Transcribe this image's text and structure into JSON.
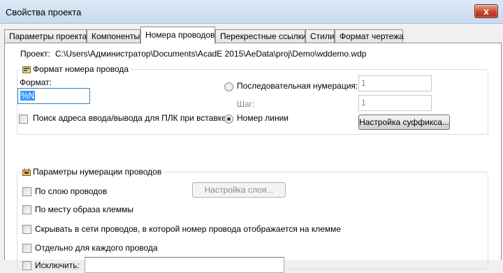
{
  "window": {
    "title": "Свойства проекта",
    "close_glyph": "x"
  },
  "tabs": [
    {
      "label": "Параметры проекта"
    },
    {
      "label": "Компоненты"
    },
    {
      "label": "Номера проводов",
      "active": true
    },
    {
      "label": "Перекрестные ссылки"
    },
    {
      "label": "Стили"
    },
    {
      "label": "Формат чертежа"
    }
  ],
  "project": {
    "label": "Проект:",
    "path": "C:\\Users\\Администратор\\Documents\\AcadE 2015\\AeData\\proj\\Demo\\wddemo.wdp"
  },
  "wire_format": {
    "title": "Формат номера провода",
    "icon": "wire-format-icon",
    "format_label": "Формат:",
    "format_value": "%N",
    "io_checkbox_label": "Поиск адреса ввода/вывода для ПЛК при вставке",
    "io_checked": false,
    "sequential_label": "Последовательная нумерация:",
    "sequential_value": "1",
    "step_label": "Шаг:",
    "step_value": "1",
    "line_number_label": "Номер линии",
    "selected_mode": "line_number",
    "suffix_button": "Настройка суффикса..."
  },
  "numbering": {
    "title": "Параметры нумерации проводов",
    "icon": "numbering-params-icon",
    "per_layer_label": "По слою проводов",
    "layer_setup_button": "Настройка слоя...",
    "terminal_label": "По месту образа клеммы",
    "hide_label": "Скрывать в сети проводов, в которой номер провода отображается на клемме",
    "each_wire_label": "Отдельно для каждого провода",
    "exclude_label": "Исключить:",
    "exclude_value": ""
  }
}
